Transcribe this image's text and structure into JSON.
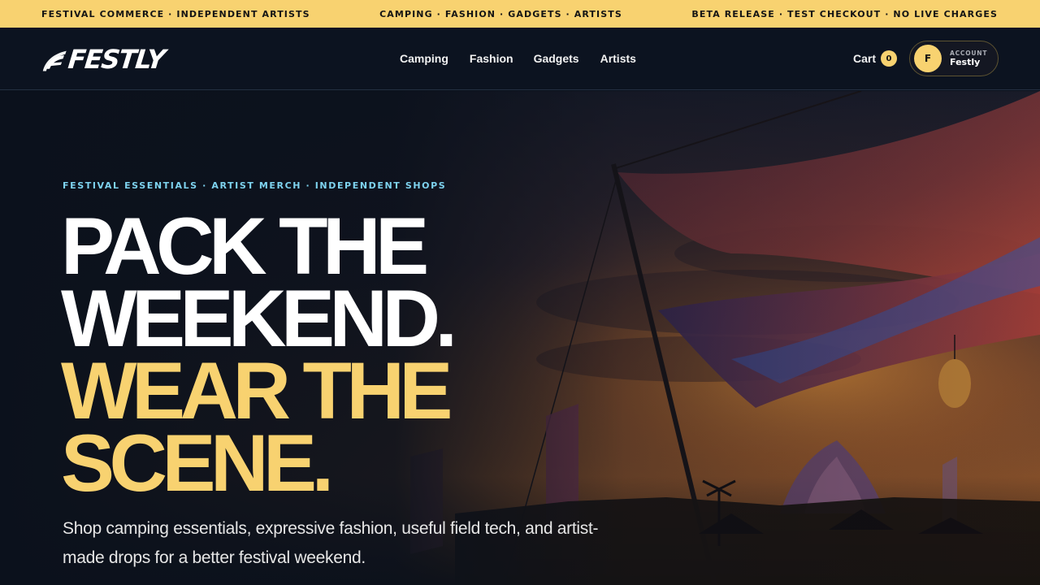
{
  "ticker": {
    "left": "FESTIVAL COMMERCE · INDEPENDENT ARTISTS",
    "center": "CAMPING · FASHION · GADGETS · ARTISTS",
    "right": "BETA RELEASE · TEST CHECKOUT · NO LIVE CHARGES"
  },
  "nav": {
    "logo_text": "FESTLY",
    "links": [
      "Camping",
      "Fashion",
      "Gadgets",
      "Artists"
    ],
    "cart": {
      "label": "Cart",
      "count": "0"
    },
    "account": {
      "initial": "F",
      "caption": "ACCOUNT",
      "name": "Festly"
    }
  },
  "hero": {
    "eyebrow": "FESTIVAL ESSENTIALS · ARTIST MERCH · INDEPENDENT SHOPS",
    "headline": {
      "line1": "PACK THE",
      "line2": "WEEKEND.",
      "line3": "WEAR THE",
      "line4": "SCENE."
    },
    "lede": "Shop camping essentials, expressive fashion, useful field tech, and artist-made drops for a better festival weekend."
  },
  "colors": {
    "accent_gold": "#f8d270",
    "eyebrow_blue": "#7ed3ef",
    "nav_bg": "#0c1320",
    "page_bg": "#0b111c"
  }
}
